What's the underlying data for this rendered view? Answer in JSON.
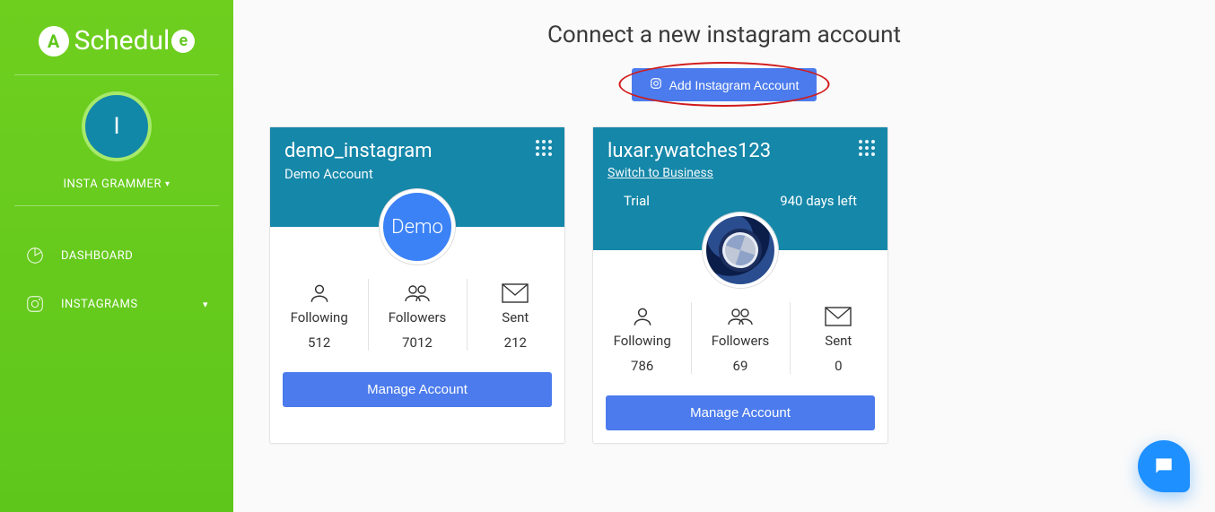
{
  "brand": {
    "name_left": "Schedul",
    "badge_a": "A",
    "badge_e": "e"
  },
  "user": {
    "avatar_initial": "I",
    "display_name": "INSTA GRAMMER"
  },
  "nav": {
    "dashboard": "DASHBOARD",
    "instagrams": "INSTAGRAMS"
  },
  "page": {
    "title": "Connect a new instagram account",
    "add_button": "Add Instagram Account"
  },
  "accounts": [
    {
      "username": "demo_instagram",
      "subtitle": "Demo Account",
      "subtitle_is_link": false,
      "profile_label": "Demo",
      "badge_left": "",
      "badge_right": "",
      "stats": {
        "following_label": "Following",
        "following": "512",
        "followers_label": "Followers",
        "followers": "7012",
        "sent_label": "Sent",
        "sent": "212"
      },
      "manage_label": "Manage Account"
    },
    {
      "username": "luxar.ywatches123",
      "subtitle": "Switch to Business",
      "subtitle_is_link": true,
      "profile_label": "",
      "badge_left": "Trial",
      "badge_right": "940 days left",
      "stats": {
        "following_label": "Following",
        "following": "786",
        "followers_label": "Followers",
        "followers": "69",
        "sent_label": "Sent",
        "sent": "0"
      },
      "manage_label": "Manage Account"
    }
  ],
  "colors": {
    "accent": "#4b7bec",
    "sidebar": "#5ec61b",
    "card_header": "#1587a9"
  }
}
